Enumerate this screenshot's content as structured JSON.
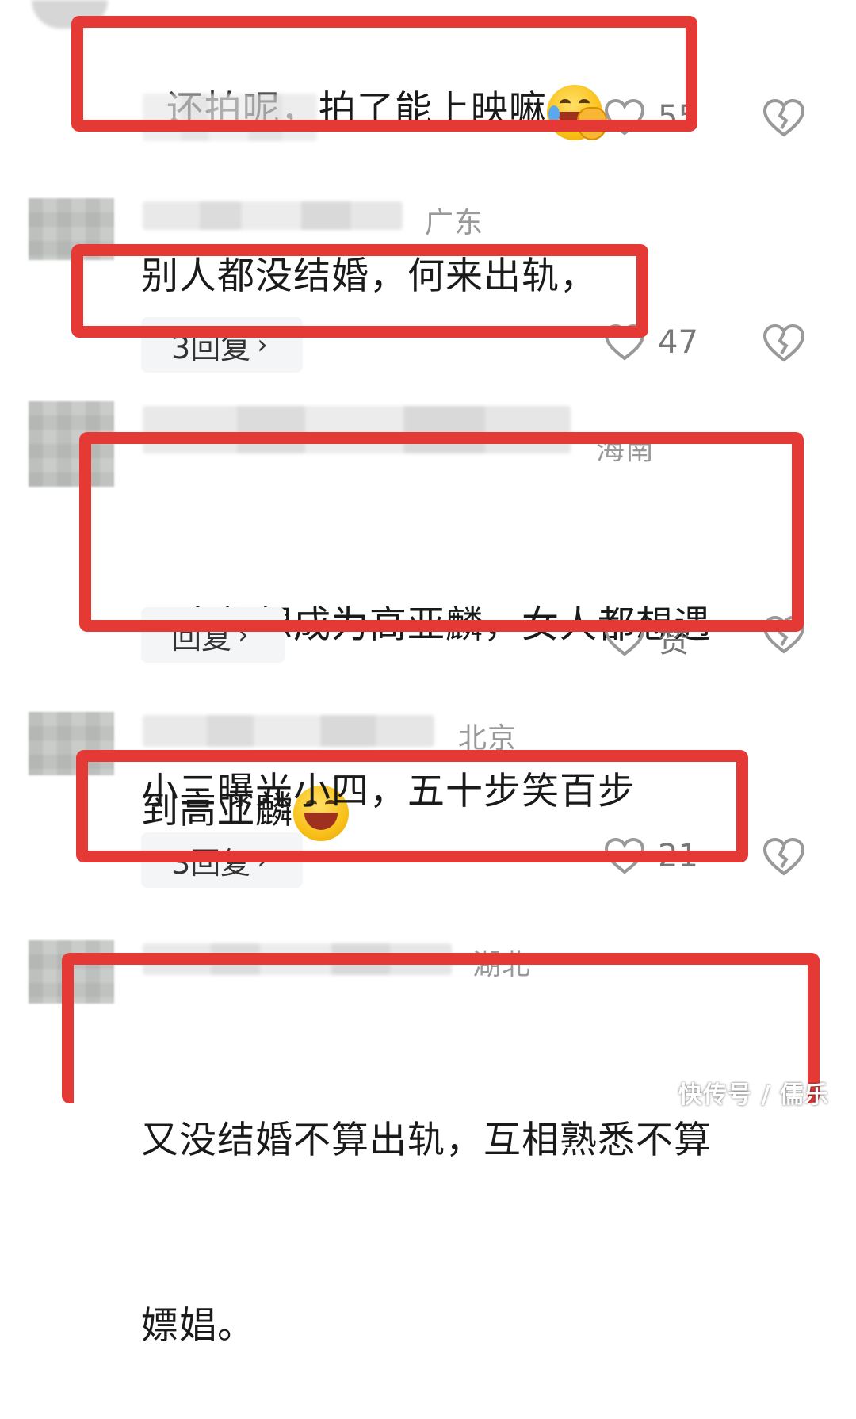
{
  "comments": [
    {
      "location": "",
      "text": "还拍呢，拍了能上映嘛",
      "emoji": "facepalm-laughing-emoji",
      "reply_label": "",
      "likes": "55"
    },
    {
      "location": "广东",
      "text": "别人都没结婚，何来出轨，",
      "emoji": "",
      "reply_label": "3回复",
      "likes": "47"
    },
    {
      "location": "海南",
      "text_line1": "男人都想成为高亚麟，女人都想遇",
      "text_line2": "到高亚麟",
      "emoji": "grinning-squinting-emoji",
      "reply_label": "回复",
      "likes": "赞"
    },
    {
      "location": "北京",
      "text": "小三曝光小四，五十步笑百步",
      "emoji": "",
      "reply_label": "3回复",
      "likes": "21"
    },
    {
      "location": "湖北",
      "text_line1": "又没结婚不算出轨，互相熟悉不算",
      "text_line2": "嫖娼。",
      "emoji": ""
    }
  ],
  "chevron": "›",
  "watermark": "快传号 / 儒乐",
  "colors": {
    "highlight": "#e53935",
    "text": "#1a1a1a",
    "meta": "#999999"
  },
  "icons": {
    "like": "heart-outline-icon",
    "dislike": "broken-heart-icon"
  }
}
